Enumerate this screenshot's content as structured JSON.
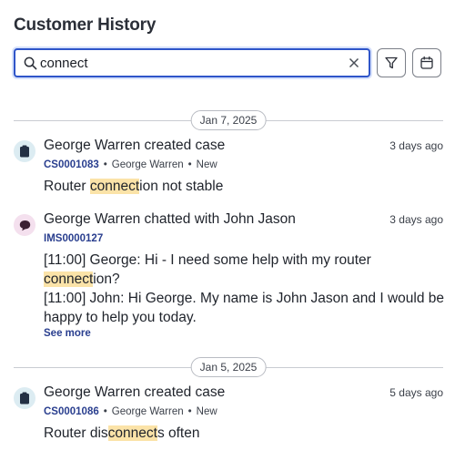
{
  "header": {
    "title": "Customer History"
  },
  "search": {
    "value": "connect"
  },
  "groups": [
    {
      "date": "Jan 7, 2025",
      "entries": [
        {
          "type": "case",
          "icon": "case-icon",
          "heading": "George Warren created case",
          "ago": "3 days ago",
          "id": "CS0001083",
          "owner": "George Warren",
          "status": "New",
          "body": {
            "pre": "Router ",
            "hl": "connect",
            "post": "ion not stable"
          }
        },
        {
          "type": "chat",
          "icon": "chat-bubble-icon",
          "heading": "George Warren chatted with John Jason",
          "ago": "3 days ago",
          "id": "IMS0000127",
          "line1_pre": "[11:00] George: Hi - I need some help with my router",
          "line1_hl": "connect",
          "line1_post": "ion?",
          "line2": "[11:00] John: Hi George. My name is John Jason and I would be happy to help you today.",
          "see_more": "See more"
        }
      ]
    },
    {
      "date": "Jan 5, 2025",
      "entries": [
        {
          "type": "case",
          "icon": "case-icon",
          "heading": "George Warren created case",
          "ago": "5 days ago",
          "id": "CS0001086",
          "owner": "George Warren",
          "status": "New",
          "body": {
            "pre": "Router dis",
            "hl": "connect",
            "post": "s often"
          }
        }
      ]
    }
  ],
  "colors": {
    "accent": "#2f55c9",
    "highlight": "#fbe3a8",
    "link": "#2a3f8f"
  }
}
